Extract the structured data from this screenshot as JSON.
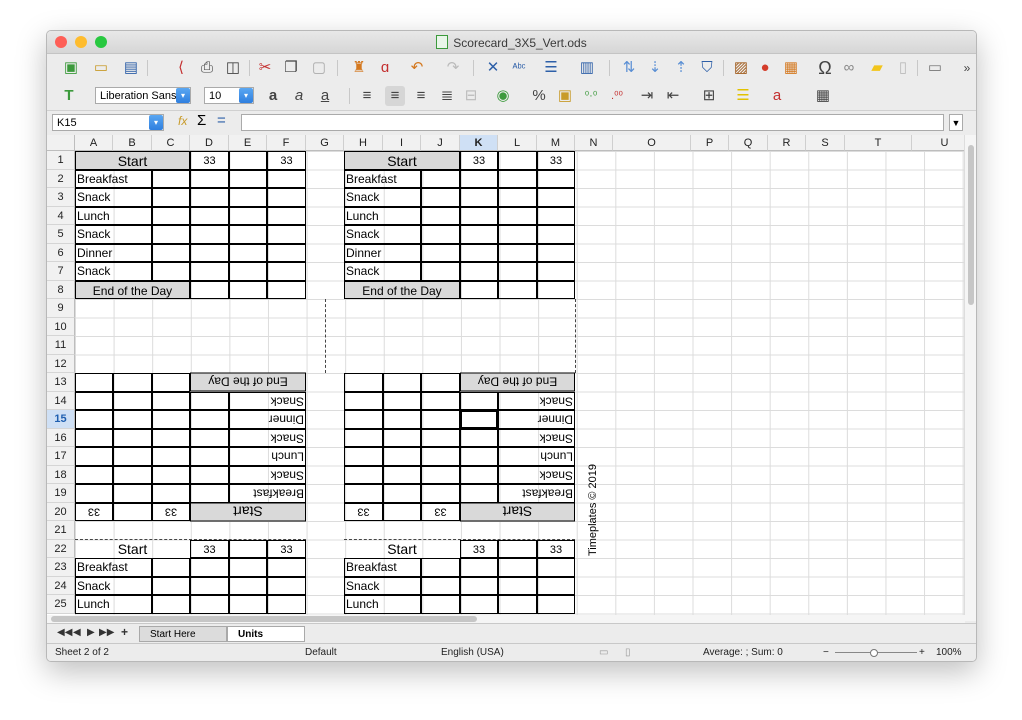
{
  "window": {
    "title": "Scorecard_3X5_Vert.ods"
  },
  "formatting": {
    "font_name": "Liberation Sans",
    "font_size": "10"
  },
  "formula_bar": {
    "cell_ref": "K15",
    "content": ""
  },
  "icons": {
    "toolbar1": [
      "new-document-icon",
      "open-icon",
      "save-icon",
      "export-pdf-icon",
      "print-icon",
      "print-preview-icon",
      "cut-icon",
      "copy-icon",
      "paste-icon",
      "clone-formatting-icon",
      "clear-formatting-icon",
      "undo-icon",
      "redo-icon",
      "find-replace-icon",
      "spelling-icon",
      "row-icon",
      "column-icon",
      "sort-icon",
      "sort-ascending-icon",
      "sort-descending-icon",
      "autofilter-icon",
      "insert-image-icon",
      "insert-chart-icon",
      "pivot-table-icon",
      "special-character-icon",
      "hyperlink-icon",
      "comment-icon",
      "headers-footers-icon",
      "define-print-area-icon"
    ],
    "toolbar2": [
      "styles-icon",
      "bold-icon",
      "italic-icon",
      "underline-icon",
      "align-left-icon",
      "align-center-icon",
      "align-right-icon",
      "justify-icon",
      "merge-center-icon",
      "currency-icon",
      "percent-icon",
      "number-format-icon",
      "add-decimal-icon",
      "delete-decimal-icon",
      "increase-indent-icon",
      "decrease-indent-icon",
      "borders-icon",
      "border-style-icon",
      "background-color-icon",
      "font-color-icon",
      "toggle-grid-icon"
    ]
  },
  "formula_symbols": {
    "function_wizard": "fx",
    "sum": "Σ",
    "equals": "="
  },
  "columns": [
    "A",
    "B",
    "C",
    "D",
    "E",
    "F",
    "G",
    "H",
    "I",
    "J",
    "K",
    "L",
    "M",
    "N",
    "O",
    "P",
    "Q",
    "R",
    "S",
    "T",
    "U"
  ],
  "rows": [
    "1",
    "2",
    "3",
    "4",
    "5",
    "6",
    "7",
    "8",
    "9",
    "10",
    "11",
    "12",
    "13",
    "14",
    "15",
    "16",
    "17",
    "18",
    "19",
    "20",
    "21",
    "22",
    "23",
    "24",
    "25"
  ],
  "active_cell": {
    "column": "K",
    "row": "15"
  },
  "cards": {
    "start_label": "Start",
    "score_label": "33",
    "meals": [
      "Breakfast",
      "Snack",
      "Lunch",
      "Snack",
      "Dinner",
      "Snack"
    ],
    "end_label": "End of the Day",
    "partial_meals": [
      "Breakfast",
      "Snack",
      "Lunch"
    ]
  },
  "watermark": "Timeplates © 2019",
  "sheet_tabs": [
    {
      "label": "Start Here First!",
      "active": false
    },
    {
      "label": "Units Tracker",
      "active": true
    }
  ],
  "tab_nav": {
    "first": "◀◀",
    "prev": "◀",
    "next": "▶",
    "last": "▶▶",
    "add": "+"
  },
  "status": {
    "sheet": "Sheet 2 of 2",
    "page_style": "Default",
    "language": "English (USA)",
    "aggregate": "Average: ; Sum: 0",
    "zoom_minus": "−",
    "zoom_plus": "+",
    "zoom": "100%"
  }
}
